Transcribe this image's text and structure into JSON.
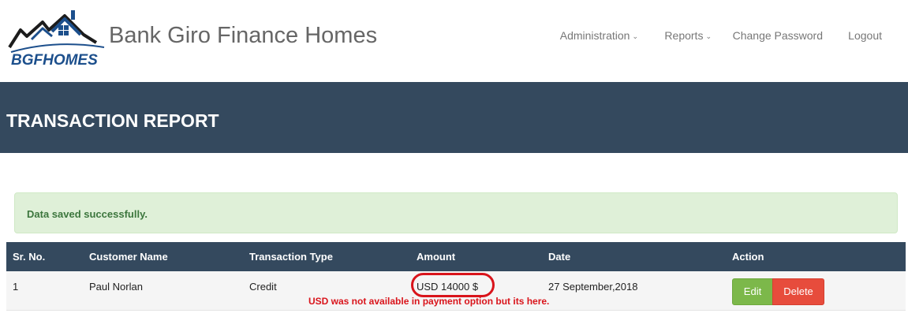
{
  "brand": {
    "logo_text": "BGFHOMES",
    "title": "Bank Giro Finance Homes",
    "logo_color": "#1c4f8c"
  },
  "nav": {
    "items": [
      {
        "label": "Administration",
        "dropdown": true
      },
      {
        "label": "Reports",
        "dropdown": true
      },
      {
        "label": "Change Password",
        "dropdown": false
      },
      {
        "label": "Logout",
        "dropdown": false
      }
    ]
  },
  "page": {
    "title": "TRANSACTION REPORT",
    "header_color": "#34495e"
  },
  "alert": {
    "message": "Data saved successfully.",
    "type": "success"
  },
  "table": {
    "columns": [
      "Sr. No.",
      "Customer Name",
      "Transaction Type",
      "Amount",
      "Date",
      "Action"
    ],
    "rows": [
      {
        "sr_no": "1",
        "customer_name": "Paul Norlan",
        "transaction_type": "Credit",
        "amount": "USD 14000 $",
        "date": "27 September,2018",
        "actions": {
          "edit": "Edit",
          "delete": "Delete"
        }
      }
    ]
  },
  "annotation": {
    "text": "USD was not available in payment option but its here.",
    "color": "#d9141b"
  }
}
